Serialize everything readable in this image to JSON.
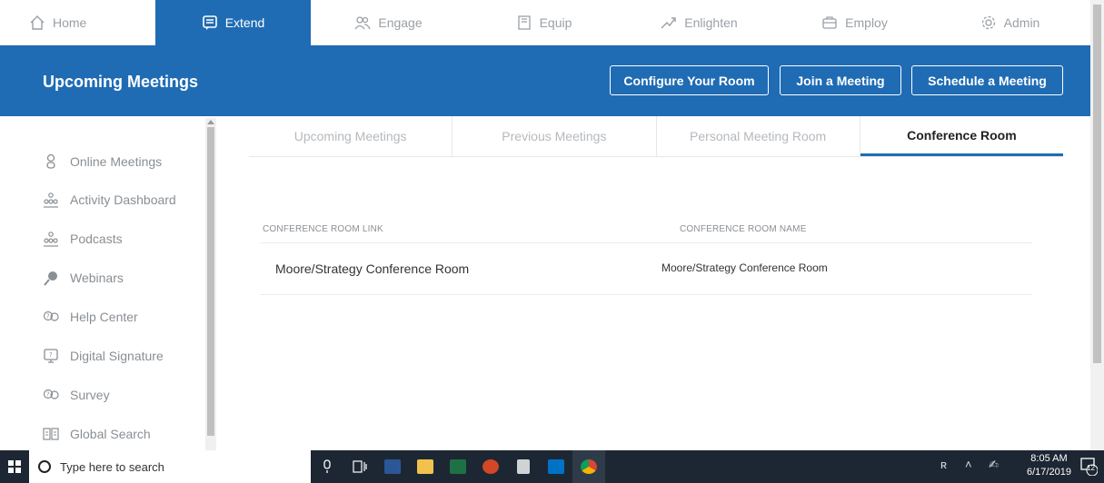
{
  "topnav": {
    "items": [
      {
        "label": "Home",
        "icon": "home-icon"
      },
      {
        "label": "Extend",
        "icon": "message-icon"
      },
      {
        "label": "Engage",
        "icon": "people-icon"
      },
      {
        "label": "Equip",
        "icon": "book-icon"
      },
      {
        "label": "Enlighten",
        "icon": "trend-icon"
      },
      {
        "label": "Employ",
        "icon": "briefcase-icon"
      },
      {
        "label": "Admin",
        "icon": "gear-icon"
      }
    ],
    "active": "Extend"
  },
  "header": {
    "title": "Upcoming Meetings",
    "buttons": [
      "Configure Your Room",
      "Join a Meeting",
      "Schedule a Meeting"
    ]
  },
  "sidebar": {
    "items": [
      {
        "label": "Online Meetings",
        "icon": "person-icon"
      },
      {
        "label": "Activity Dashboard",
        "icon": "group-icon"
      },
      {
        "label": "Podcasts",
        "icon": "group-icon"
      },
      {
        "label": "Webinars",
        "icon": "globe-icon"
      },
      {
        "label": "Help Center",
        "icon": "help-icon"
      },
      {
        "label": "Digital Signature",
        "icon": "signature-icon"
      },
      {
        "label": "Survey",
        "icon": "survey-icon"
      },
      {
        "label": "Global Search",
        "icon": "search-grid-icon"
      }
    ]
  },
  "tabs": [
    "Upcoming Meetings",
    "Previous Meetings",
    "Personal Meeting Room",
    "Conference Room"
  ],
  "active_tab": "Conference Room",
  "table": {
    "columns": [
      "CONFERENCE ROOM LINK",
      "CONFERENCE ROOM NAME"
    ],
    "rows": [
      [
        "Moore/Strategy Conference Room",
        "Moore/Strategy Conference Room"
      ]
    ]
  },
  "taskbar": {
    "search_placeholder": "Type here to search",
    "time": "8:05 AM",
    "date": "6/17/2019",
    "notification_count": "12"
  },
  "colors": {
    "brand_blue": "#1f6cb4",
    "taskbar": "#1d2733"
  }
}
